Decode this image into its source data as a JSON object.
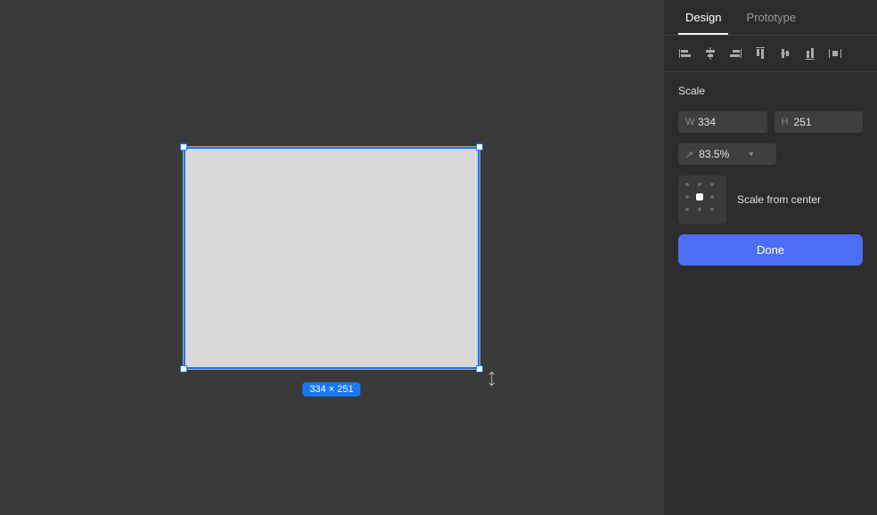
{
  "tabs": [
    {
      "id": "design",
      "label": "Design",
      "active": true
    },
    {
      "id": "prototype",
      "label": "Prototype",
      "active": false
    }
  ],
  "alignment": {
    "icons": [
      {
        "name": "align-left",
        "symbol": "⊢"
      },
      {
        "name": "align-center-h",
        "symbol": "⊣"
      },
      {
        "name": "align-right",
        "symbol": "⊤"
      },
      {
        "name": "align-top",
        "symbol": "⊥"
      },
      {
        "name": "align-middle-v",
        "symbol": "⊦"
      },
      {
        "name": "align-bottom",
        "symbol": "⊧"
      },
      {
        "name": "distribute",
        "symbol": "⊨"
      }
    ]
  },
  "scale_section": {
    "title": "Scale",
    "width_label": "W",
    "height_label": "H",
    "width_value": "334",
    "height_value": "251",
    "scale_value": "83.5%",
    "scale_from_label": "Scale from center",
    "done_label": "Done"
  },
  "canvas": {
    "size_label": "334 × 251"
  },
  "colors": {
    "accent": "#4c6ef5",
    "selection": "#1877f2"
  }
}
